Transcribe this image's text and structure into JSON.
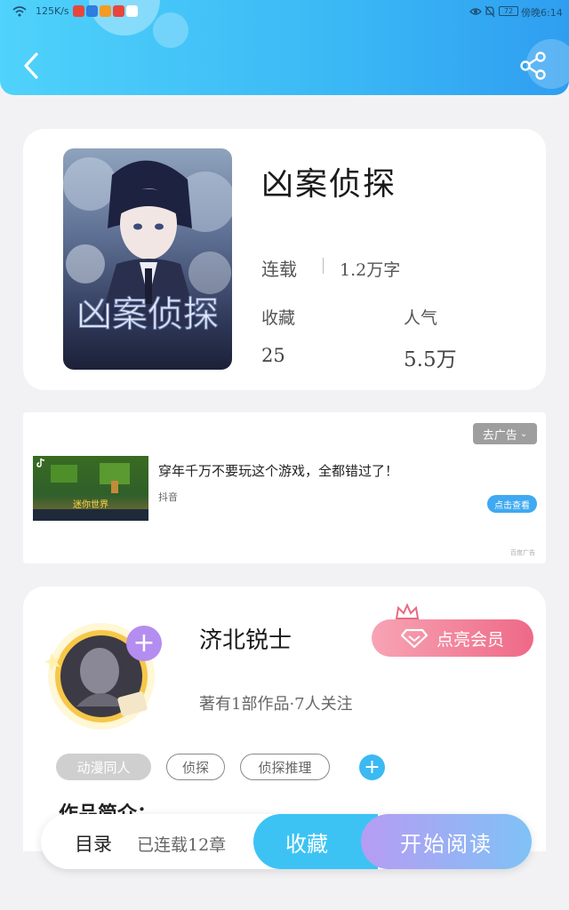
{
  "status_bar": {
    "net_speed": "125K/s",
    "battery": "72",
    "time": "傍晚6:14"
  },
  "book": {
    "title": "凶案侦探",
    "status": "连载",
    "word_count": "1.2万字",
    "collect_label": "收藏",
    "collect_value": "25",
    "popularity_label": "人气",
    "popularity_value": "5.5万"
  },
  "ad": {
    "remove_label": "去广告",
    "title": "穿年千万不要玩这个游戏，全都错过了！",
    "source": "抖音",
    "cta": "点击查看",
    "mark": "百度广告",
    "game_name": "迷你世界"
  },
  "author": {
    "name": "济北锐士",
    "stats": "著有1部作品·7人关注",
    "vip_button": "点亮会员",
    "tags": [
      "动漫同人",
      "侦探",
      "侦探推理"
    ],
    "intro_heading": "作品简介："
  },
  "bottom_bar": {
    "catalog_label": "目录",
    "chapters": "已连载12章",
    "collect_button": "收藏",
    "read_button": "开始阅读"
  },
  "colors": {
    "header_start": "#4fd2fb",
    "header_end": "#2f9ef0",
    "vip_pink": "#f06a88",
    "read_purple": "#a58ff0"
  }
}
